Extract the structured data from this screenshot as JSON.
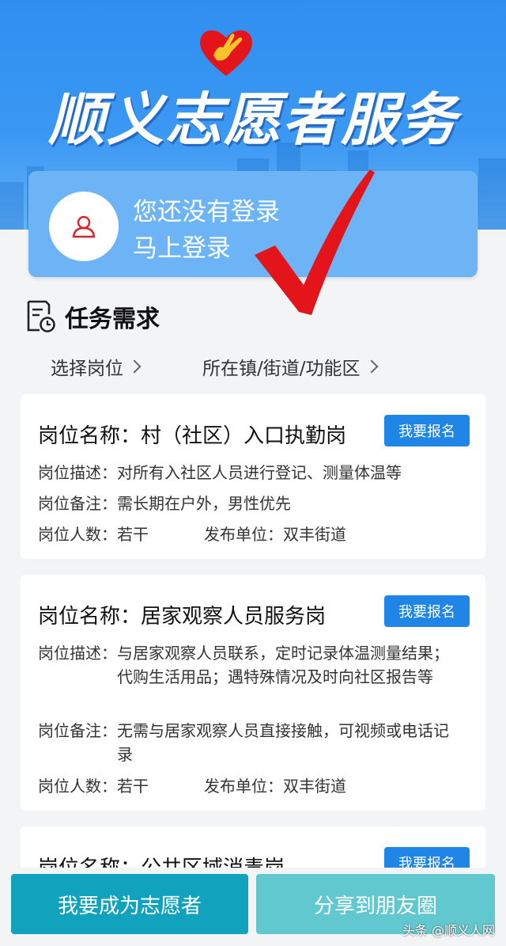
{
  "banner": {
    "title": "顺义志愿者服务",
    "logo_icon": "heart-hand-icon",
    "brand_color": "#2f8ff0"
  },
  "login": {
    "line1": "您还没有登录",
    "line2": "马上登录",
    "avatar_icon": "user-icon"
  },
  "annotation": {
    "icon": "red-checkmark-icon",
    "color": "#e3151a"
  },
  "section": {
    "title": "任务需求",
    "icon": "task-clock-icon"
  },
  "filters": {
    "position": "选择岗位",
    "location": "所在镇/街道/功能区"
  },
  "jobs": [
    {
      "title": "岗位名称：村（社区）入口执勤岗",
      "apply": "我要报名",
      "desc_label": "岗位描述：",
      "desc": "对所有入社区人员进行登记、测量体温等",
      "note_label": "岗位备注：",
      "note": "需长期在户外，男性优先",
      "count_label": "岗位人数：",
      "count": "若干",
      "publisher_label": "发布单位：",
      "publisher": "双丰街道"
    },
    {
      "title": "岗位名称：居家观察人员服务岗",
      "apply": "我要报名",
      "desc_label": "岗位描述：",
      "desc": "与居家观察人员联系，定时记录体温测量结果；代购生活用品；遇特殊情况及时向社区报告等",
      "note_label": "岗位备注：",
      "note": "无需与居家观察人员直接接触，可视频或电话记录",
      "count_label": "岗位人数：",
      "count": "若干",
      "publisher_label": "发布单位：",
      "publisher": "双丰街道"
    },
    {
      "title": "岗位名称：公共区域消毒岗",
      "apply": "我要报名"
    }
  ],
  "actions": {
    "become_volunteer": "我要成为志愿者",
    "share": "分享到朋友圈"
  },
  "watermark": "头条 @顺义人网",
  "colors": {
    "apply_button": "#1f86e8",
    "primary_button": "#11a2be",
    "share_button": "#62c8cf"
  }
}
